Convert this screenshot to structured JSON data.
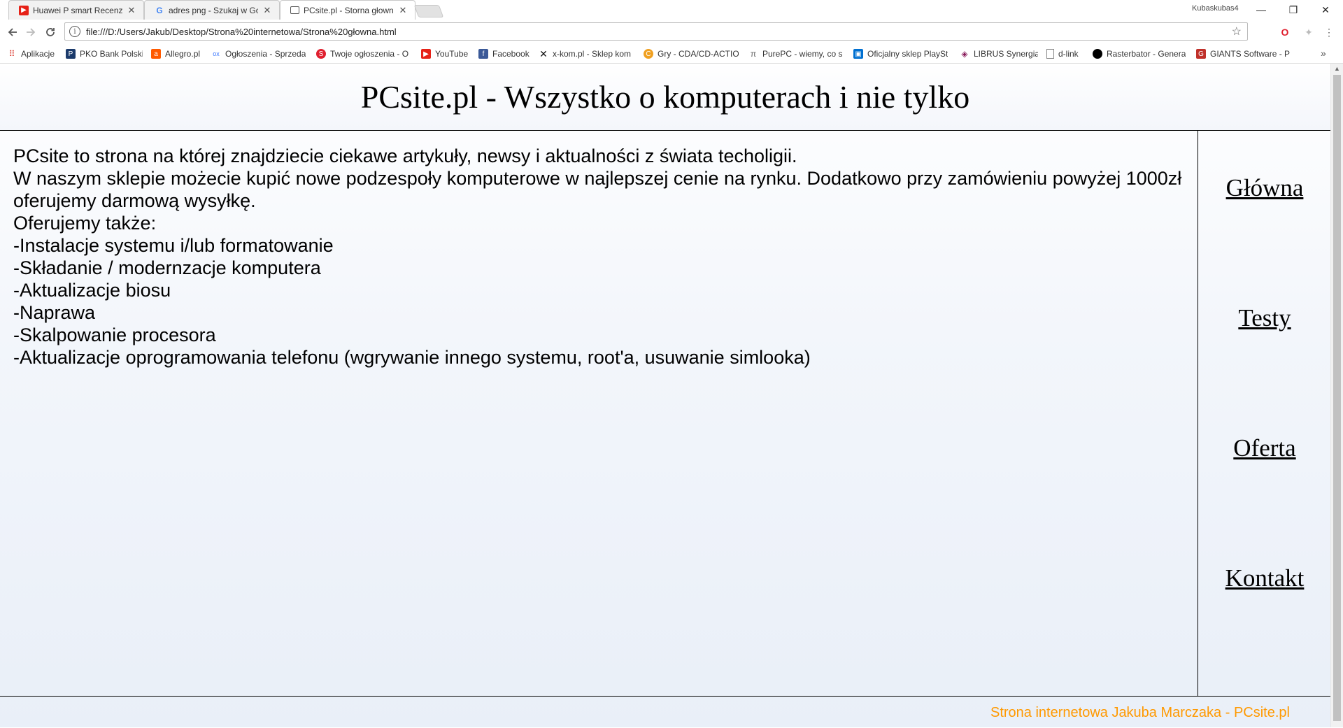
{
  "browser": {
    "tabs": [
      {
        "title": "Huawei P smart Recenzja",
        "icon": "youtube-icon",
        "icon_color": "#e62117",
        "active": false
      },
      {
        "title": "adres png - Szukaj w Google",
        "icon": "google-icon",
        "icon_color": "#4285f4",
        "active": false
      },
      {
        "title": "PCsite.pl - Storna głowna",
        "icon": "page-icon",
        "icon_color": "#555555",
        "active": true
      }
    ],
    "profile": "Kubaskubas4",
    "window_controls": {
      "minimize": "—",
      "restore": "❐",
      "close": "✕"
    },
    "url": "file:///D:/Users/Jakub/Desktop/Strona%20internetowa/Strona%20głowna.html",
    "bookmarks": [
      {
        "label": "Aplikacje",
        "icon": "apps-grid-icon",
        "color": "#d93025"
      },
      {
        "label": "PKO Bank Polski",
        "icon": "pko-icon",
        "color": "#1b3a6b"
      },
      {
        "label": "Allegro.pl",
        "icon": "allegro-icon",
        "color": "#ff5a00"
      },
      {
        "label": "Ogłoszenia - Sprzeda",
        "icon": "olx-icon",
        "color": "#3a77ff"
      },
      {
        "label": "Twoje ogłoszenia - O",
        "icon": "otomoto-icon",
        "color": "#e0202f"
      },
      {
        "label": "YouTube",
        "icon": "youtube-icon",
        "color": "#e62117"
      },
      {
        "label": "Facebook",
        "icon": "facebook-icon",
        "color": "#3b5998"
      },
      {
        "label": "x-kom.pl - Sklep kom",
        "icon": "xkom-icon",
        "color": "#111111"
      },
      {
        "label": "Gry - CDA/CD-ACTIO",
        "icon": "cda-icon",
        "color": "#f0a020"
      },
      {
        "label": "PurePC - wiemy, co s",
        "icon": "purepc-icon",
        "color": "#666666"
      },
      {
        "label": "Oficjalny sklep PlaySt",
        "icon": "playstation-icon",
        "color": "#0070d1"
      },
      {
        "label": "LIBRUS Synergia",
        "icon": "librus-icon",
        "color": "#8a1d5c"
      },
      {
        "label": "d-link",
        "icon": "page-icon",
        "color": "#888888"
      },
      {
        "label": "Rasterbator - Genera",
        "icon": "circle-icon",
        "color": "#000000"
      },
      {
        "label": "GIANTS Software - P",
        "icon": "giants-icon",
        "color": "#c0302a"
      }
    ],
    "more_bookmarks": "»"
  },
  "page": {
    "header_title": "PCsite.pl - Wszystko o komputerach i nie tylko",
    "content_lines": [
      "PCsite to strona na której znajdziecie ciekawe artykuły, newsy i aktualności z świata techoligii.",
      "W naszym sklepie możecie kupić nowe podzespoły komputerowe w najlepszej cenie na rynku. Dodatkowo przy zamówieniu powyżej 1000zł oferujemy darmową wysyłkę.",
      "Oferujemy także:",
      "-Instalacje systemu i/lub formatowanie",
      "-Składanie / modernzacje komputera",
      "-Aktualizacje biosu",
      "-Naprawa",
      "-Skalpowanie procesora",
      "-Aktualizacje oprogramowania telefonu (wgrywanie innego systemu, root'a, usuwanie simlooka)"
    ],
    "nav": [
      "Główna",
      "Testy",
      "Oferta",
      "Kontakt"
    ],
    "footer": "Strona internetowa Jakuba Marczaka - PCsite.pl",
    "footer_color": "#ff9900"
  }
}
